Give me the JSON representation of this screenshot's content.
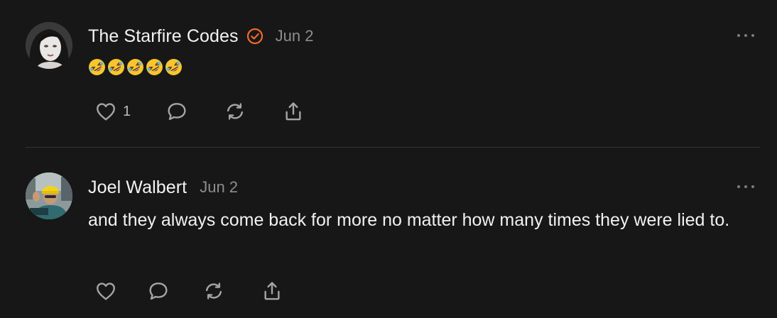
{
  "posts": [
    {
      "author": "The Starfire Codes",
      "verified": true,
      "date": "Jun 2",
      "reaction_emoji": [
        "rolling-on-floor-laughing",
        "rolling-on-floor-laughing",
        "rolling-on-floor-laughing",
        "rolling-on-floor-laughing",
        "rolling-on-floor-laughing"
      ],
      "like_count": "1",
      "avatar": "woman-dark-hair-avatar"
    },
    {
      "author": "Joel Walbert",
      "verified": false,
      "date": "Jun 2",
      "text": "and they always come back for more no matter how many times they were lied to.",
      "avatar": "man-yellow-cap-avatar"
    }
  ],
  "icons": {
    "more": "more-options-icon",
    "like": "heart-icon",
    "reply": "comment-bubble-icon",
    "repost": "repost-icon",
    "share": "share-icon",
    "verified": "verified-badge-icon"
  },
  "colors": {
    "background": "#171717",
    "verified_badge": "#f06a2b",
    "secondary_text": "#8d8d8d",
    "icon": "#a5a5a5"
  }
}
